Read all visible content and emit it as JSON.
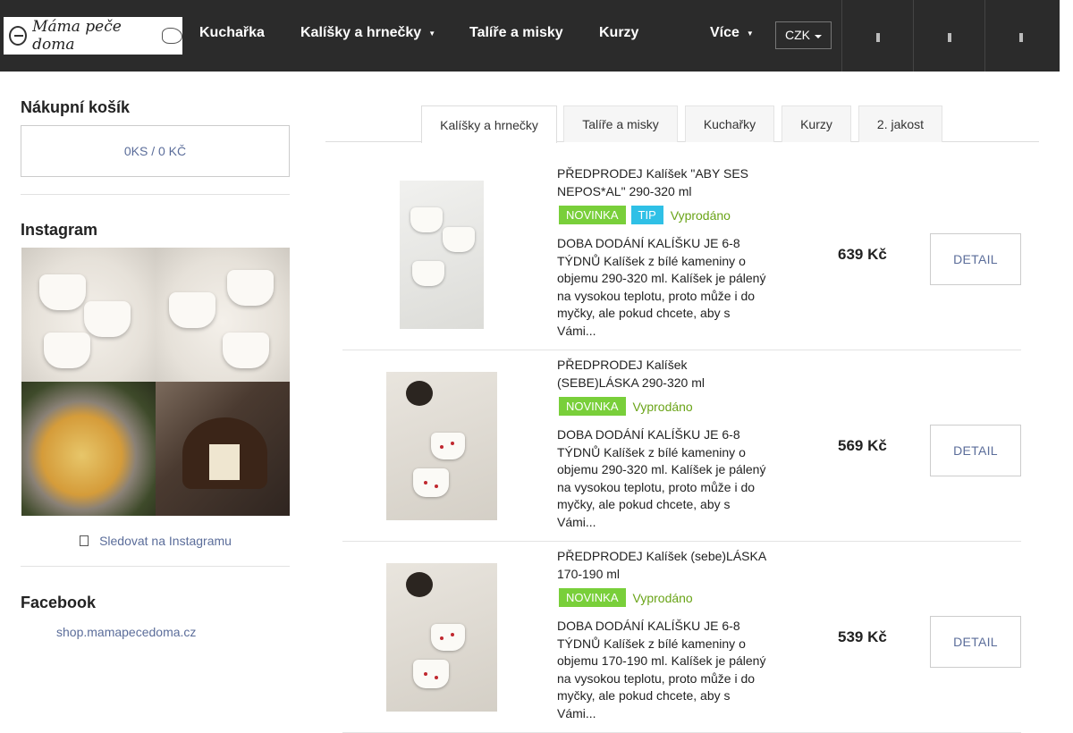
{
  "header": {
    "logo_text": "Máma peče doma",
    "nav": [
      {
        "label": "Kuchařka"
      },
      {
        "label": "Kalíšky a hrnečky",
        "caret": "▼"
      },
      {
        "label": "Talíře a misky"
      },
      {
        "label": "Kurzy"
      },
      {
        "label": "Více",
        "caret": "▼"
      }
    ],
    "currency": "CZK",
    "icons": [
      "search-icon",
      "user-icon",
      "cart-icon"
    ],
    "background_color": "#2b2b2b"
  },
  "sidebar": {
    "cart_title": "Nákupní košík",
    "cart_summary": "0KS / 0 KČ",
    "instagram_title": "Instagram",
    "instagram_follow": "Sledovat na Instagramu",
    "facebook_title": "Facebook",
    "facebook_link": "shop.mamapecedoma.cz"
  },
  "tabs": [
    {
      "label": "Kalíšky a hrnečky",
      "active": true
    },
    {
      "label": "Talíře a misky",
      "active": false
    },
    {
      "label": "Kuchařky",
      "active": false
    },
    {
      "label": "Kurzy",
      "active": false
    },
    {
      "label": "2. jakost",
      "active": false
    }
  ],
  "products": [
    {
      "name": "PŘEDPRODEJ Kalíšek \"ABY SES NEPOS*AL\" 290-320 ml",
      "badges": [
        "NOVINKA",
        "TIP"
      ],
      "availability": "Vyprodáno",
      "description": "DOBA DODÁNÍ KALÍŠKU JE 6-8 TÝDNŮ Kalíšek z bílé kameniny o objemu 290-320 ml. Kalíšek je pálený na vysokou teplotu, proto může i do myčky, ale pokud chcete, aby s Vámi...",
      "price": "639 Kč",
      "detail_label": "DETAIL"
    },
    {
      "name": "PŘEDPRODEJ Kalíšek (SEBE)LÁSKA 290-320 ml",
      "badges": [
        "NOVINKA"
      ],
      "availability": "Vyprodáno",
      "description": "DOBA DODÁNÍ KALÍŠKU JE 6-8 TÝDNŮ Kalíšek z bílé kameniny o objemu 290-320 ml. Kalíšek je pálený na vysokou teplotu, proto může i do myčky, ale pokud chcete, aby s Vámi...",
      "price": "569 Kč",
      "detail_label": "DETAIL"
    },
    {
      "name": "PŘEDPRODEJ Kalíšek (sebe)LÁSKA 170-190 ml",
      "badges": [
        "NOVINKA"
      ],
      "availability": "Vyprodáno",
      "description": "DOBA DODÁNÍ KALÍŠKU JE 6-8 TÝDNŮ Kalíšek z bílé kameniny o objemu 170-190 ml. Kalíšek je pálený na vysokou teplotu, proto může i do myčky, ale pokud chcete, aby s Vámi...",
      "price": "539 Kč",
      "detail_label": "DETAIL"
    }
  ],
  "colors": {
    "badge_new": "#79cf3a",
    "badge_tip": "#2fc0e6",
    "sold_out": "#6aa418",
    "link": "#5b6d9a"
  }
}
